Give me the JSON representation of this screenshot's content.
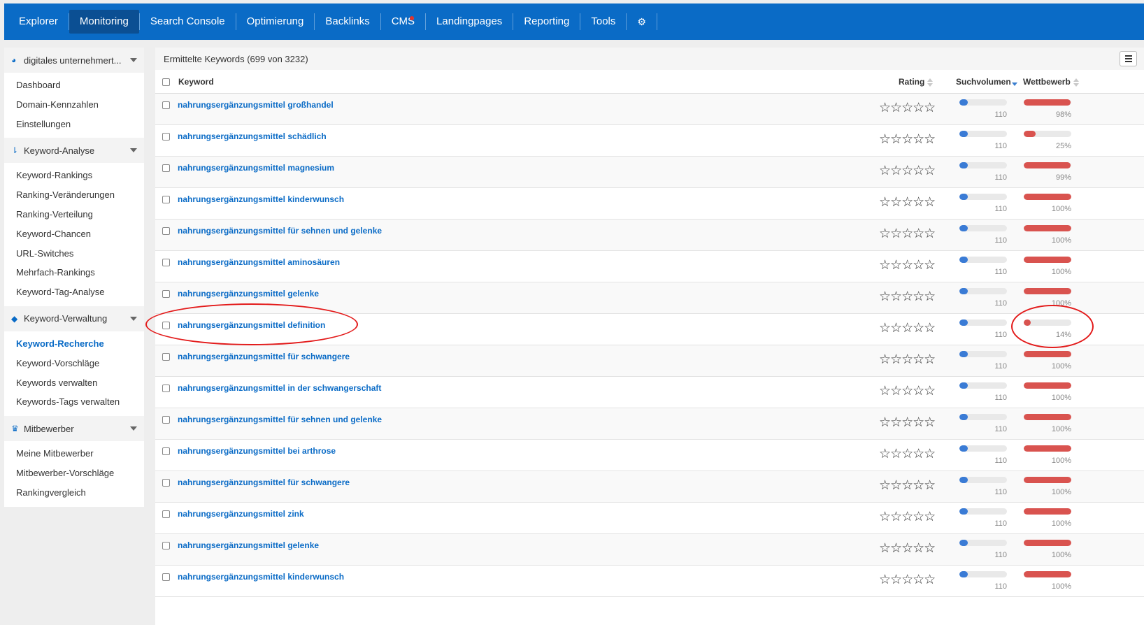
{
  "nav": {
    "items": [
      "Explorer",
      "Monitoring",
      "Search Console",
      "Optimierung",
      "Backlinks",
      "CMS",
      "Landingpages",
      "Reporting",
      "Tools"
    ],
    "active": "Monitoring",
    "settings_icon": "gear-icon"
  },
  "sidebar": {
    "sections": [
      {
        "label": "digitales unternehmert...",
        "icon": "dashboard-icon",
        "items": [
          "Dashboard",
          "Domain-Kennzahlen",
          "Einstellungen"
        ]
      },
      {
        "label": "Keyword-Analyse",
        "icon": "sort-list-icon",
        "items": [
          "Keyword-Rankings",
          "Ranking-Veränderungen",
          "Ranking-Verteilung",
          "Keyword-Chancen",
          "URL-Switches",
          "Mehrfach-Rankings",
          "Keyword-Tag-Analyse"
        ]
      },
      {
        "label": "Keyword-Verwaltung",
        "icon": "tags-icon",
        "items": [
          "Keyword-Recherche",
          "Keyword-Vorschläge",
          "Keywords verwalten",
          "Keywords-Tags verwalten"
        ]
      },
      {
        "label": "Mitbewerber",
        "icon": "trophy-icon",
        "items": [
          "Meine Mitbewerber",
          "Mitbewerber-Vorschläge",
          "Rankingvergleich"
        ]
      }
    ],
    "active_item": "Keyword-Recherche"
  },
  "panel": {
    "title": "Ermittelte Keywords (699 von 3232)"
  },
  "table": {
    "columns": {
      "keyword": "Keyword",
      "rating": "Rating",
      "volume": "Suchvolumen",
      "competition": "Wettbewerb"
    },
    "colors": {
      "volume_bar": "#3a7bd5",
      "competition_bar": "#d9534f",
      "link": "#0a6bc6"
    },
    "rows": [
      {
        "keyword": "nahrungsergänzungsmittel großhandel",
        "stars": "☆☆☆☆☆",
        "volume": "110",
        "volume_fraction": 0.18,
        "competition": "98%",
        "competition_fraction": 0.98
      },
      {
        "keyword": "nahrungsergänzungsmittel schädlich",
        "stars": "☆☆☆☆☆",
        "volume": "110",
        "volume_fraction": 0.18,
        "competition": "25%",
        "competition_fraction": 0.25
      },
      {
        "keyword": "nahrungsergänzungsmittel magnesium",
        "stars": "☆☆☆☆☆",
        "volume": "110",
        "volume_fraction": 0.18,
        "competition": "99%",
        "competition_fraction": 0.99
      },
      {
        "keyword": "nahrungsergänzungsmittel kinderwunsch",
        "stars": "☆☆☆☆☆",
        "volume": "110",
        "volume_fraction": 0.18,
        "competition": "100%",
        "competition_fraction": 1.0
      },
      {
        "keyword": "nahrungsergänzungsmittel für sehnen und gelenke",
        "stars": "☆☆☆☆☆",
        "volume": "110",
        "volume_fraction": 0.18,
        "competition": "100%",
        "competition_fraction": 1.0
      },
      {
        "keyword": "nahrungsergänzungsmittel aminosäuren",
        "stars": "☆☆☆☆☆",
        "volume": "110",
        "volume_fraction": 0.18,
        "competition": "100%",
        "competition_fraction": 1.0
      },
      {
        "keyword": "nahrungsergänzungsmittel gelenke",
        "stars": "☆☆☆☆☆",
        "volume": "110",
        "volume_fraction": 0.18,
        "competition": "100%",
        "competition_fraction": 1.0
      },
      {
        "keyword": "nahrungsergänzungsmittel definition",
        "stars": "☆☆☆☆☆",
        "volume": "110",
        "volume_fraction": 0.18,
        "competition": "14%",
        "competition_fraction": 0.14
      },
      {
        "keyword": "nahrungsergänzungsmittel für schwangere",
        "stars": "☆☆☆☆☆",
        "volume": "110",
        "volume_fraction": 0.18,
        "competition": "100%",
        "competition_fraction": 1.0
      },
      {
        "keyword": "nahrungsergänzungsmittel in der schwangerschaft",
        "stars": "☆☆☆☆☆",
        "volume": "110",
        "volume_fraction": 0.18,
        "competition": "100%",
        "competition_fraction": 1.0
      },
      {
        "keyword": "nahrungsergänzungsmittel für sehnen und gelenke",
        "stars": "☆☆☆☆☆",
        "volume": "110",
        "volume_fraction": 0.18,
        "competition": "100%",
        "competition_fraction": 1.0
      },
      {
        "keyword": "nahrungsergänzungsmittel bei arthrose",
        "stars": "☆☆☆☆☆",
        "volume": "110",
        "volume_fraction": 0.18,
        "competition": "100%",
        "competition_fraction": 1.0
      },
      {
        "keyword": "nahrungsergänzungsmittel für schwangere",
        "stars": "☆☆☆☆☆",
        "volume": "110",
        "volume_fraction": 0.18,
        "competition": "100%",
        "competition_fraction": 1.0
      },
      {
        "keyword": "nahrungsergänzungsmittel zink",
        "stars": "☆☆☆☆☆",
        "volume": "110",
        "volume_fraction": 0.18,
        "competition": "100%",
        "competition_fraction": 1.0
      },
      {
        "keyword": "nahrungsergänzungsmittel gelenke",
        "stars": "☆☆☆☆☆",
        "volume": "110",
        "volume_fraction": 0.18,
        "competition": "100%",
        "competition_fraction": 1.0
      },
      {
        "keyword": "nahrungsergänzungsmittel kinderwunsch",
        "stars": "☆☆☆☆☆",
        "volume": "110",
        "volume_fraction": 0.18,
        "competition": "100%",
        "competition_fraction": 1.0
      }
    ]
  },
  "annotations": {
    "color": "#e31b1b"
  }
}
